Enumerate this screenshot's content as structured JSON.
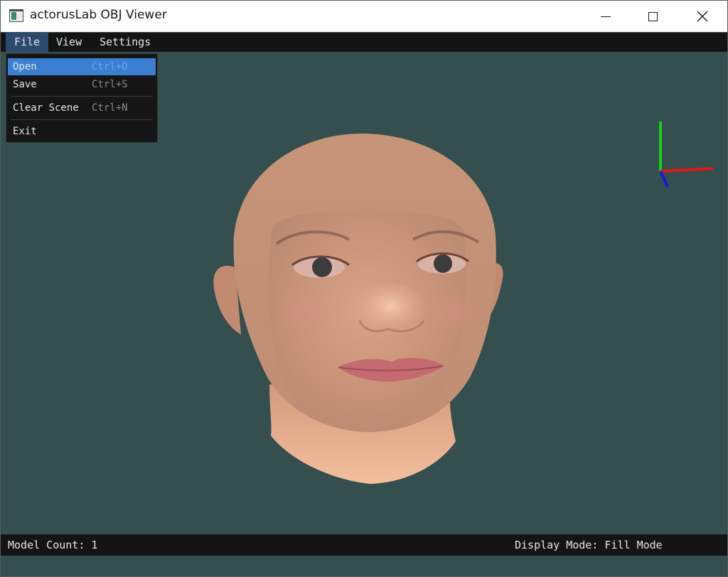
{
  "window": {
    "title": "actorusLab OBJ Viewer",
    "controls": {
      "minimize": "minimize",
      "maximize": "maximize",
      "close": "✕"
    }
  },
  "menubar": {
    "items": [
      {
        "label": "File",
        "active": true
      },
      {
        "label": "View",
        "active": false
      },
      {
        "label": "Settings",
        "active": false
      }
    ]
  },
  "file_menu": {
    "items": [
      {
        "label": "Open",
        "shortcut": "Ctrl+O",
        "highlighted": true
      },
      {
        "label": "Save",
        "shortcut": "Ctrl+S",
        "highlighted": false
      },
      {
        "label": "Clear Scene",
        "shortcut": "Ctrl+N",
        "highlighted": false
      },
      {
        "label": "Exit",
        "shortcut": "",
        "highlighted": false
      }
    ]
  },
  "viewport": {
    "background_color": "#354f4e",
    "model": "3d-head-icon",
    "axis_colors": {
      "x": "#e01818",
      "y": "#18d018",
      "z": "#1818e0"
    }
  },
  "statusbar": {
    "model_count": "Model Count: 1",
    "display_mode": "Display Mode: Fill Mode"
  }
}
